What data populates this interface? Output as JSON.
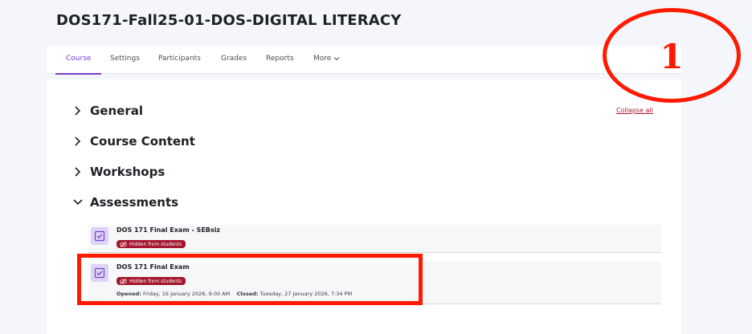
{
  "course": {
    "title": "DOS171-Fall25-01-DOS-DIGITAL LITERACY"
  },
  "nav": {
    "items": [
      {
        "label": "Course",
        "active": true
      },
      {
        "label": "Settings"
      },
      {
        "label": "Participants"
      },
      {
        "label": "Grades"
      },
      {
        "label": "Reports"
      },
      {
        "label": "More"
      }
    ]
  },
  "content": {
    "collapse_all": "Collapse all",
    "sections": [
      {
        "title": "General",
        "expanded": false
      },
      {
        "title": "Course Content",
        "expanded": false
      },
      {
        "title": "Workshops",
        "expanded": false
      },
      {
        "title": "Assessments",
        "expanded": true
      }
    ],
    "activities": [
      {
        "name": "DOS 171 Final Exam - SEBsiz",
        "badge": "Hidden from students"
      },
      {
        "name": "DOS 171 Final Exam",
        "badge": "Hidden from students",
        "opened_label": "Opened:",
        "opened_value": "Friday, 16 January 2026, 9:00 AM",
        "closed_label": "Closed:",
        "closed_value": "Tuesday, 27 January 2026, 7:34 PM"
      }
    ]
  },
  "annotation": {
    "number": "1"
  },
  "colors": {
    "accent": "#7a3fd1",
    "badge": "#a3162e",
    "annotation": "#ff1a00",
    "icon_bg": "#dcd3f5"
  }
}
